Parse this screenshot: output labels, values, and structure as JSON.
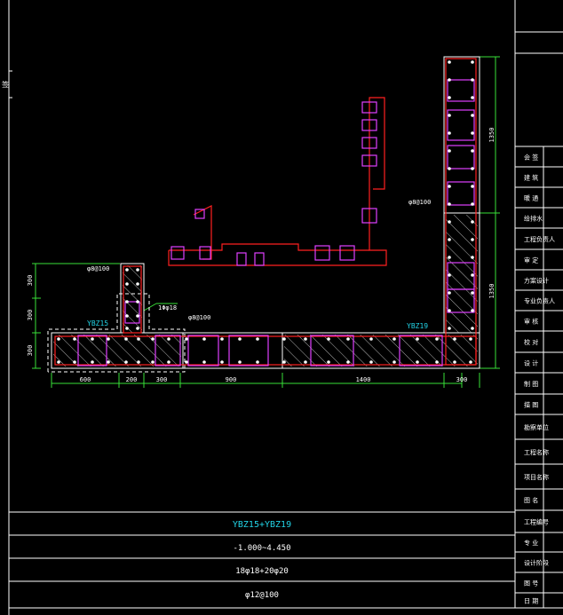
{
  "drawing": {
    "labels": {
      "ybz15": "YBZ15",
      "ybz19": "YBZ19",
      "stirrup_left": "φ8@100",
      "stirrup_mid": "φ8@100",
      "stirrup_right": "φ8@100",
      "rebar_small": "1Φφ18"
    },
    "dims_bottom": [
      "600",
      "200",
      "300",
      "900",
      "1400",
      "300"
    ],
    "dims_left": [
      "300",
      "300",
      "300"
    ],
    "dims_right": [
      "1350",
      "1350"
    ]
  },
  "table": {
    "title": "YBZ15+YBZ19",
    "elevation": "-1.000~4.450",
    "longitudinal": "18φ18+20φ20",
    "stirrup": "φ12@100"
  },
  "titleblock": {
    "rows": [
      "会 签",
      "建 筑",
      "暖 通",
      "给排水",
      "工程负责人",
      "审 定",
      "方案设计",
      "专业负责人",
      "审 核",
      "校 对",
      "设 计",
      "制 图",
      "描 图",
      "勘察单位",
      "工程名称",
      "项目名称",
      "图 名",
      "工程编号",
      "专 业",
      "设计阶段",
      "图 号",
      "日 期"
    ]
  },
  "left_margin_text": "签"
}
